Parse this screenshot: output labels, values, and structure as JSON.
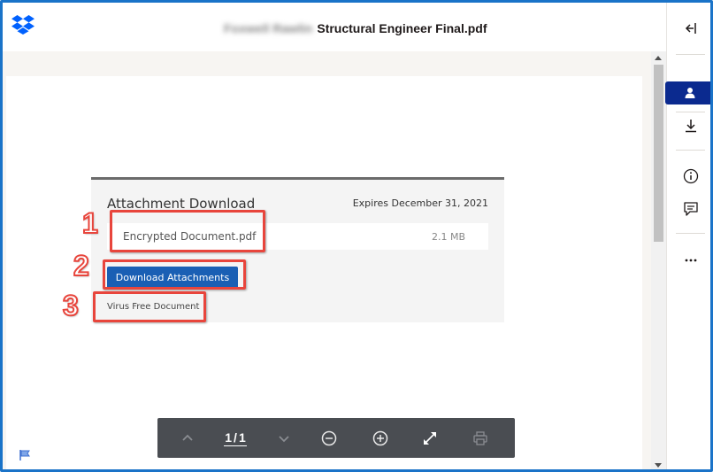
{
  "header": {
    "owner_name": "Foxwell Rawlin",
    "file_title": "Structural Engineer Final.pdf"
  },
  "document": {
    "attachment_title": "Attachment Download",
    "expires": "Expires December 31, 2021",
    "file_name": "Encrypted Document.pdf",
    "file_size": "2.1 MB",
    "download_button": "Download Attachments",
    "virus_text": "Virus Free Document",
    "callouts": [
      "1",
      "2",
      "3"
    ]
  },
  "toolbar": {
    "page_current": "1",
    "page_sep": "/",
    "page_total": "1",
    "items": [
      "chevron-up-icon",
      "chevron-down-icon",
      "zoom-out-icon",
      "zoom-in-icon",
      "fullscreen-icon",
      "print-icon"
    ]
  },
  "rail": {
    "items": [
      "collapse-icon",
      "person-icon",
      "download-icon",
      "info-icon",
      "comment-icon",
      "more-icon"
    ]
  },
  "colors": {
    "frame_border": "#1a73c8",
    "rail_active": "#0b2a8f",
    "download_button": "#1a5fb4",
    "callout_red": "#e8453c",
    "toolbar_bg": "#4a4d52"
  }
}
